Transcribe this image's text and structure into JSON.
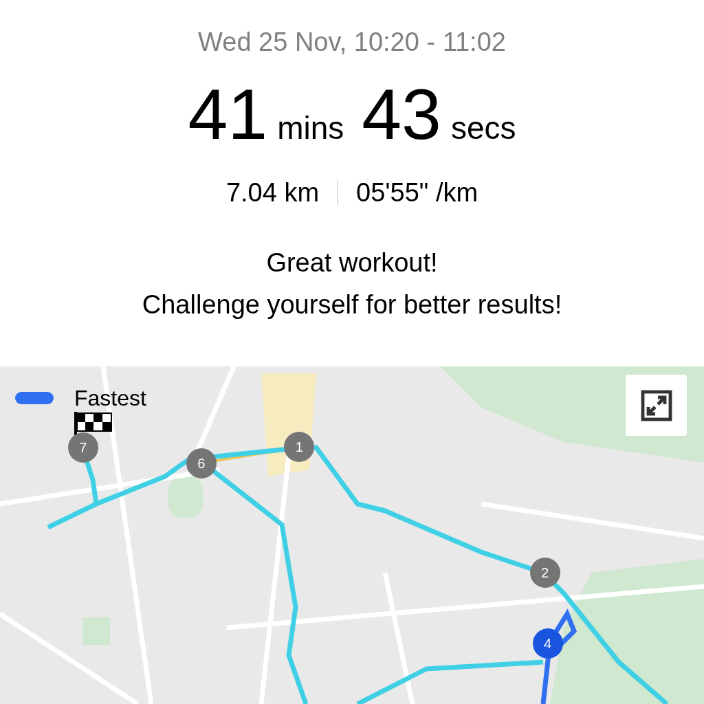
{
  "header": {
    "date_range": "Wed 25 Nov, 10:20 - 11:02"
  },
  "duration": [
    {
      "value": "41",
      "unit": "mins"
    },
    {
      "value": "43",
      "unit": "secs"
    }
  ],
  "stats": [
    "7.04 km",
    "05'55\" /km"
  ],
  "message": [
    "Great workout!",
    "Challenge yourself for better results!"
  ],
  "map": {
    "legend": {
      "label": "Fastest",
      "color": "#2f6ff0"
    },
    "markers": [
      {
        "label": "7",
        "color": "#757575"
      },
      {
        "label": "6",
        "color": "#757575"
      },
      {
        "label": "1",
        "color": "#757575"
      },
      {
        "label": "2",
        "color": "#757575"
      },
      {
        "label": "4",
        "color": "#1a55e0"
      }
    ]
  }
}
